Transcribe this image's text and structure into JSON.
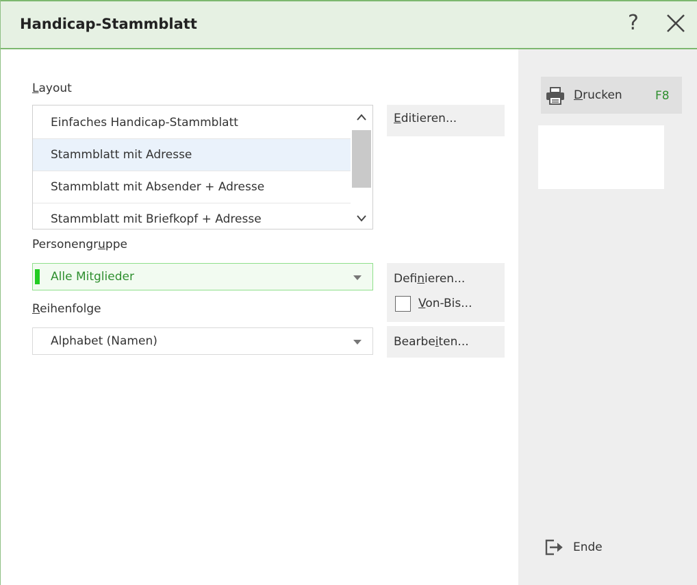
{
  "window": {
    "title": "Handicap-Stammblatt",
    "help": "?"
  },
  "layout": {
    "label_key": "L",
    "label_rest": "ayout",
    "items": [
      {
        "label": "Einfaches Handicap-Stammblatt",
        "selected": false
      },
      {
        "label": "Stammblatt mit Adresse",
        "selected": true
      },
      {
        "label": "Stammblatt mit Absender + Adresse",
        "selected": false
      },
      {
        "label": "Stammblatt mit Briefkopf + Adresse",
        "selected": false
      }
    ],
    "scroll_up": "^",
    "scroll_down": "v",
    "edit_key": "E",
    "edit_rest": "ditieren..."
  },
  "personengruppe": {
    "label_pre": "Personengr",
    "label_key": "u",
    "label_rest": "ppe",
    "value": "Alle Mitglieder",
    "define_pre": "Defi",
    "define_key": "n",
    "define_rest": "ieren...",
    "vonbis_key": "V",
    "vonbis_rest": "on-Bis...",
    "vonbis_checked": false
  },
  "reihenfolge": {
    "label_key": "R",
    "label_rest": "eihenfolge",
    "value": "Alphabet (Namen)",
    "edit_pre": "Bearbe",
    "edit_key": "i",
    "edit_rest": "ten..."
  },
  "side": {
    "print_key": "D",
    "print_rest": "rucken",
    "print_shortcut": "F8",
    "end_label": "Ende"
  },
  "colors": {
    "accent_green": "#2f8f2f",
    "title_bg": "#e6f1e3",
    "selection": "#eaf2fb"
  }
}
